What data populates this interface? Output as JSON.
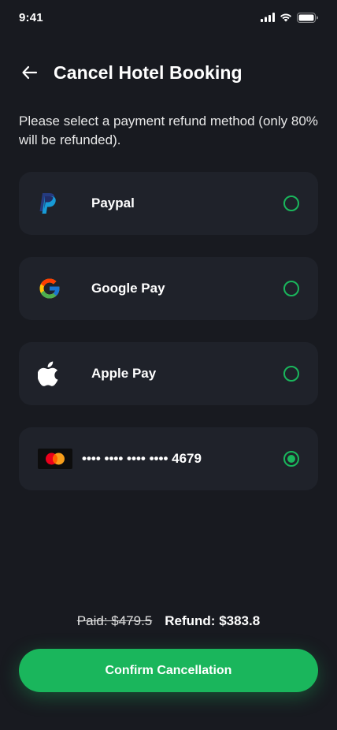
{
  "status_bar": {
    "time": "9:41"
  },
  "header": {
    "title": "Cancel Hotel Booking"
  },
  "instruction": "Please select a payment refund method (only 80% will be refunded).",
  "methods": [
    {
      "label": "Paypal",
      "icon": "paypal-icon",
      "selected": false
    },
    {
      "label": "Google Pay",
      "icon": "google-icon",
      "selected": false
    },
    {
      "label": "Apple Pay",
      "icon": "apple-icon",
      "selected": false
    },
    {
      "label": "•••• •••• •••• •••• 4679",
      "icon": "mastercard-icon",
      "selected": true
    }
  ],
  "summary": {
    "paid": "Paid: $479.5",
    "refund": "Refund: $383.8"
  },
  "confirm_label": "Confirm Cancellation",
  "colors": {
    "background": "#181a20",
    "card": "#1f222a",
    "accent": "#1ab65c"
  }
}
